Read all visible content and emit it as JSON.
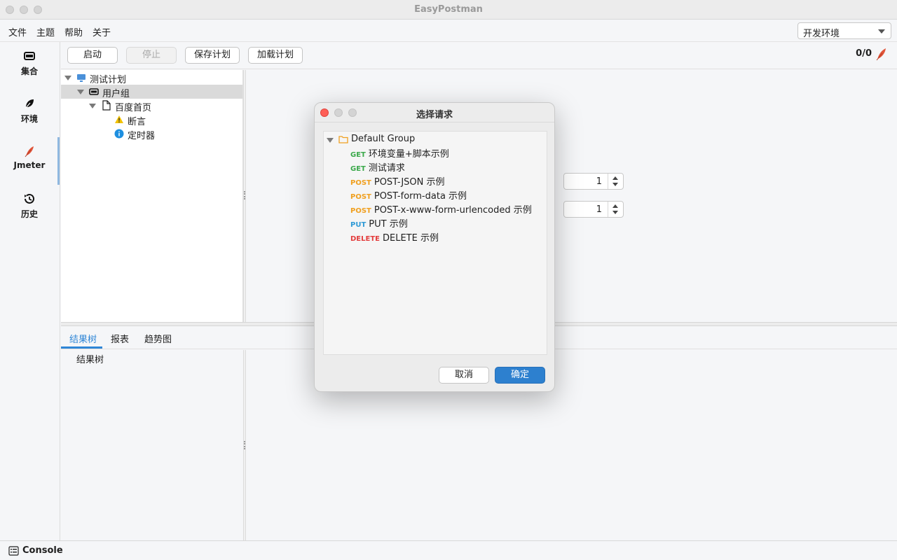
{
  "window": {
    "title": "EasyPostman"
  },
  "menu": {
    "items": [
      "文件",
      "主题",
      "帮助",
      "关于"
    ]
  },
  "environment": {
    "selected": "开发环境"
  },
  "sidebar": {
    "items": [
      {
        "label": "集合",
        "icon": "collection-icon"
      },
      {
        "label": "环境",
        "icon": "leaf-icon"
      },
      {
        "label": "Jmeter",
        "icon": "feather-icon"
      },
      {
        "label": "历史",
        "icon": "history-icon"
      }
    ],
    "active": "Jmeter"
  },
  "toolbar": {
    "start": "启动",
    "stop": "停止",
    "save_plan": "保存计划",
    "load_plan": "加载计划",
    "counter": "0/0"
  },
  "plan_tree": {
    "root": "测试计划",
    "group": "用户组",
    "request": "百度首页",
    "assertion": "断言",
    "timer": "定时器"
  },
  "spinners": {
    "first": "1",
    "second": "1"
  },
  "bottom_tabs": {
    "items": [
      "结果树",
      "报表",
      "趋势图"
    ],
    "active": "结果树"
  },
  "result_tree": {
    "root": "结果树"
  },
  "statusbar": {
    "console": "Console"
  },
  "dialog": {
    "title": "选择请求",
    "group": "Default Group",
    "requests": [
      {
        "method": "GET",
        "name": "环境变量+脚本示例"
      },
      {
        "method": "GET",
        "name": "测试请求"
      },
      {
        "method": "POST",
        "name": "POST-JSON 示例"
      },
      {
        "method": "POST",
        "name": "POST-form-data 示例"
      },
      {
        "method": "POST",
        "name": "POST-x-www-form-urlencoded 示例"
      },
      {
        "method": "PUT",
        "name": "PUT 示例"
      },
      {
        "method": "DELETE",
        "name": "DELETE 示例"
      }
    ],
    "cancel": "取消",
    "confirm": "确定"
  },
  "colors": {
    "accent": "#2f86d6",
    "get": "#3aa84a",
    "post": "#f0a020",
    "put": "#2f9ad6",
    "delete": "#e33d3d",
    "confirm_button": "#2d80cf"
  }
}
